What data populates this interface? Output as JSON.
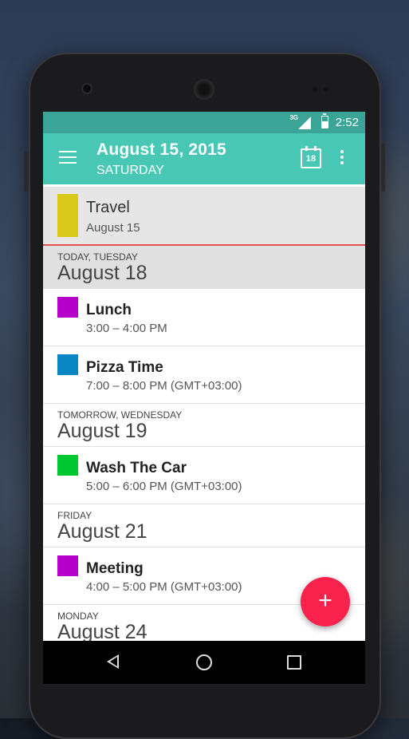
{
  "status_bar": {
    "network": "3G",
    "time": "2:52"
  },
  "app_bar": {
    "title": "August 15, 2015",
    "subtitle": "SATURDAY",
    "calendar_day": "18"
  },
  "colors": {
    "status_bar": "#3aa597",
    "app_bar": "#47c7b4",
    "fab": "#f8224c",
    "travel": "#d8c91a",
    "purple": "#b400c8",
    "blue": "#0a86c4",
    "green": "#00c832",
    "divider": "#e2514f"
  },
  "travel": {
    "name": "Travel",
    "date": "August 15"
  },
  "sections": [
    {
      "label": "TODAY, TUESDAY",
      "date": "August 18",
      "events": [
        {
          "name": "Lunch",
          "time": "3:00 – 4:00 PM"
        },
        {
          "name": "Pizza Time",
          "time": "7:00 – 8:00 PM (GMT+03:00)"
        }
      ]
    },
    {
      "label": "TOMORROW, WEDNESDAY",
      "date": "August 19",
      "events": [
        {
          "name": "Wash The Car",
          "time": "5:00 – 6:00 PM (GMT+03:00)"
        }
      ]
    },
    {
      "label": "FRIDAY",
      "date": "August 21",
      "events": [
        {
          "name": "Meeting",
          "time": "4:00 – 5:00 PM (GMT+03:00)"
        }
      ]
    },
    {
      "label": "MONDAY",
      "date": "August 24",
      "events": []
    }
  ],
  "fab": {
    "label": "+"
  },
  "icons": {
    "menu": "menu-icon",
    "calendar": "calendar-icon",
    "more": "more-vert-icon",
    "back": "back-icon",
    "home": "home-icon",
    "recents": "recents-icon"
  }
}
